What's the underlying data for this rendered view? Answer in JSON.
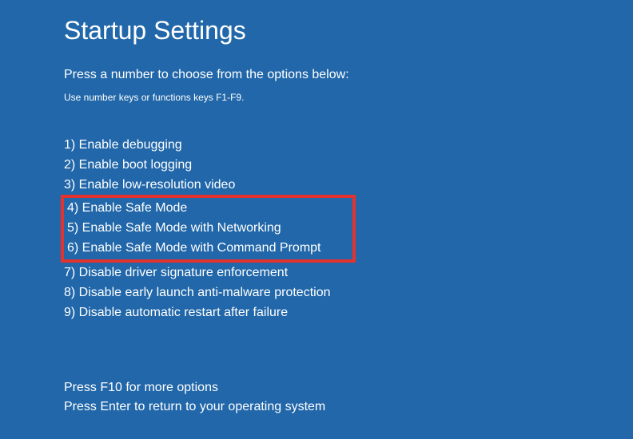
{
  "title": "Startup Settings",
  "instruction": "Press a number to choose from the options below:",
  "subinstruction": "Use number keys or functions keys F1-F9.",
  "options": [
    "1) Enable debugging",
    "2) Enable boot logging",
    "3) Enable low-resolution video",
    "4) Enable Safe Mode",
    "5) Enable Safe Mode with Networking",
    "6) Enable Safe Mode with Command Prompt",
    "7) Disable driver signature enforcement",
    "8) Disable early launch anti-malware protection",
    "9) Disable automatic restart after failure"
  ],
  "footer": {
    "line1": "Press F10 for more options",
    "line2": "Press Enter to return to your operating system"
  }
}
